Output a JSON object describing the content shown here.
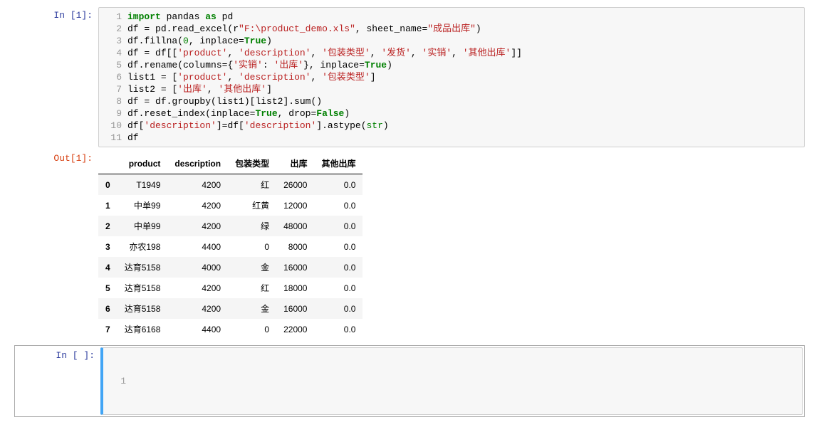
{
  "cells": {
    "in1": {
      "prompt": "In [1]:",
      "lines": [
        {
          "n": "1",
          "tokens": [
            {
              "t": "import",
              "c": "tok-kw"
            },
            {
              "t": " pandas "
            },
            {
              "t": "as",
              "c": "tok-kw"
            },
            {
              "t": " pd"
            }
          ]
        },
        {
          "n": "2",
          "tokens": [
            {
              "t": "df "
            },
            {
              "t": "="
            },
            {
              "t": " pd.read_excel(r"
            },
            {
              "t": "\"F:\\product_demo.xls\"",
              "c": "tok-str"
            },
            {
              "t": ", sheet_name"
            },
            {
              "t": "="
            },
            {
              "t": "\"成品出库\"",
              "c": "tok-str"
            },
            {
              "t": ")"
            }
          ]
        },
        {
          "n": "3",
          "tokens": [
            {
              "t": "df.fillna("
            },
            {
              "t": "0",
              "c": "tok-num"
            },
            {
              "t": ", inplace"
            },
            {
              "t": "="
            },
            {
              "t": "True",
              "c": "tok-kw"
            },
            {
              "t": ")"
            }
          ]
        },
        {
          "n": "4",
          "tokens": [
            {
              "t": "df "
            },
            {
              "t": "="
            },
            {
              "t": " df[["
            },
            {
              "t": "'product'",
              "c": "tok-str"
            },
            {
              "t": ", "
            },
            {
              "t": "'description'",
              "c": "tok-str"
            },
            {
              "t": ", "
            },
            {
              "t": "'包装类型'",
              "c": "tok-str"
            },
            {
              "t": ", "
            },
            {
              "t": "'发货'",
              "c": "tok-str"
            },
            {
              "t": ", "
            },
            {
              "t": "'实销'",
              "c": "tok-str"
            },
            {
              "t": ", "
            },
            {
              "t": "'其他出库'",
              "c": "tok-str"
            },
            {
              "t": "]]"
            }
          ]
        },
        {
          "n": "5",
          "tokens": [
            {
              "t": "df.rename(columns"
            },
            {
              "t": "="
            },
            {
              "t": "{"
            },
            {
              "t": "'实销'",
              "c": "tok-str"
            },
            {
              "t": ": "
            },
            {
              "t": "'出库'",
              "c": "tok-str"
            },
            {
              "t": "}, inplace"
            },
            {
              "t": "="
            },
            {
              "t": "True",
              "c": "tok-kw"
            },
            {
              "t": ")"
            }
          ]
        },
        {
          "n": "6",
          "tokens": [
            {
              "t": "list1 "
            },
            {
              "t": "="
            },
            {
              "t": " ["
            },
            {
              "t": "'product'",
              "c": "tok-str"
            },
            {
              "t": ", "
            },
            {
              "t": "'description'",
              "c": "tok-str"
            },
            {
              "t": ", "
            },
            {
              "t": "'包装类型'",
              "c": "tok-str"
            },
            {
              "t": "]"
            }
          ]
        },
        {
          "n": "7",
          "tokens": [
            {
              "t": "list2 "
            },
            {
              "t": "="
            },
            {
              "t": " ["
            },
            {
              "t": "'出库'",
              "c": "tok-str"
            },
            {
              "t": ", "
            },
            {
              "t": "'其他出库'",
              "c": "tok-str"
            },
            {
              "t": "]"
            }
          ]
        },
        {
          "n": "8",
          "tokens": [
            {
              "t": "df "
            },
            {
              "t": "="
            },
            {
              "t": " df.groupby(list1)[list2].sum()"
            }
          ]
        },
        {
          "n": "9",
          "tokens": [
            {
              "t": "df.reset_index(inplace"
            },
            {
              "t": "="
            },
            {
              "t": "True",
              "c": "tok-kw"
            },
            {
              "t": ", drop"
            },
            {
              "t": "="
            },
            {
              "t": "False",
              "c": "tok-kw"
            },
            {
              "t": ")"
            }
          ]
        },
        {
          "n": "10",
          "tokens": [
            {
              "t": "df["
            },
            {
              "t": "'description'",
              "c": "tok-str"
            },
            {
              "t": "]"
            },
            {
              "t": "="
            },
            {
              "t": "df["
            },
            {
              "t": "'description'",
              "c": "tok-str"
            },
            {
              "t": "].astype("
            },
            {
              "t": "str",
              "c": "tok-builtin"
            },
            {
              "t": ")"
            }
          ]
        },
        {
          "n": "11",
          "tokens": [
            {
              "t": "df"
            }
          ]
        }
      ]
    },
    "out1": {
      "prompt": "Out[1]:",
      "table": {
        "columns": [
          "",
          "product",
          "description",
          "包装类型",
          "出库",
          "其他出库"
        ],
        "rows": [
          {
            "idx": "0",
            "product": "T1949",
            "description": "4200",
            "pack": "红",
            "out": "26000",
            "other": "0.0"
          },
          {
            "idx": "1",
            "product": "中单99",
            "description": "4200",
            "pack": "红黄",
            "out": "12000",
            "other": "0.0"
          },
          {
            "idx": "2",
            "product": "中单99",
            "description": "4200",
            "pack": "绿",
            "out": "48000",
            "other": "0.0"
          },
          {
            "idx": "3",
            "product": "亦农198",
            "description": "4400",
            "pack": "0",
            "out": "8000",
            "other": "0.0"
          },
          {
            "idx": "4",
            "product": "达育5158",
            "description": "4000",
            "pack": "金",
            "out": "16000",
            "other": "0.0"
          },
          {
            "idx": "5",
            "product": "达育5158",
            "description": "4200",
            "pack": "红",
            "out": "18000",
            "other": "0.0"
          },
          {
            "idx": "6",
            "product": "达育5158",
            "description": "4200",
            "pack": "金",
            "out": "16000",
            "other": "0.0"
          },
          {
            "idx": "7",
            "product": "达育6168",
            "description": "4400",
            "pack": "0",
            "out": "22000",
            "other": "0.0"
          }
        ]
      }
    },
    "inEmpty": {
      "prompt": "In [ ]:",
      "emptyGutter": "1"
    }
  }
}
